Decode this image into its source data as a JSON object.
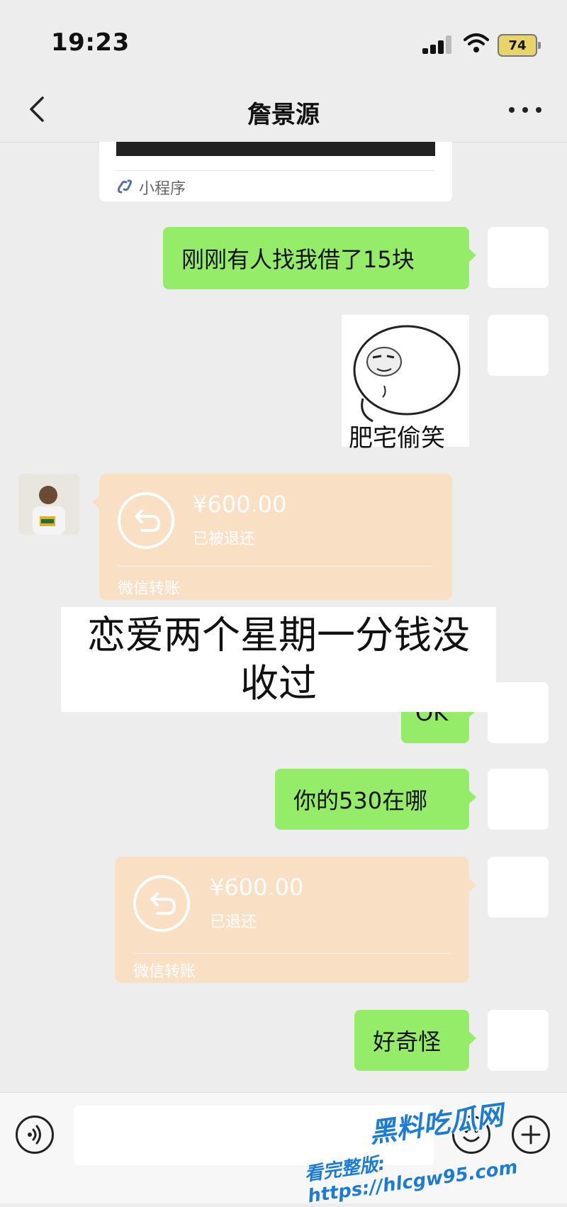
{
  "status_bar": {
    "time": "19:23",
    "battery": "74"
  },
  "header": {
    "title": "詹景源",
    "back_icon": "chevron-left-icon",
    "more_icon": "more-dots-icon"
  },
  "mini_program": {
    "label": "小程序",
    "icon": "link-icon"
  },
  "messages": {
    "m1": {
      "text": "刚刚有人找我借了15块"
    },
    "sticker": {
      "caption": "肥宅偷笑"
    },
    "transfer1": {
      "amount": "¥600.00",
      "status": "已被退还",
      "footer": "微信转账"
    },
    "m2": {
      "text": "OK"
    },
    "m3": {
      "text": "你的530在哪"
    },
    "transfer2": {
      "amount": "¥600.00",
      "status": "已退还",
      "footer": "微信转账"
    },
    "m4": {
      "text": "好奇怪"
    }
  },
  "overlay_caption": {
    "line1": "恋爱两个星期一分钱没",
    "line2": "收过"
  },
  "input_bar": {
    "voice_icon": "voice-icon",
    "emoji_icon": "emoji-icon",
    "plus_icon": "plus-icon"
  },
  "watermark": {
    "logo_text": "黑料吃瓜网",
    "url_text": "看完整版: https://hlcgw95.com"
  },
  "colors": {
    "bubble_green": "#95ec69",
    "transfer_orange": "#f9dfc4",
    "background": "#ededed",
    "watermark_blue": "#1c7bd4"
  }
}
